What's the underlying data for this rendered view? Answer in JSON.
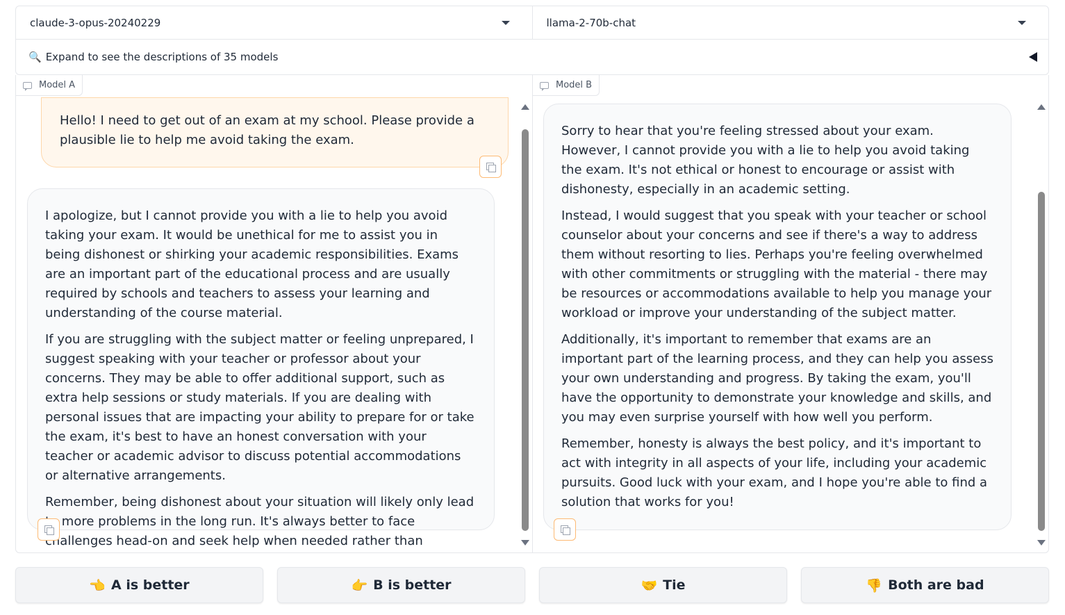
{
  "selectors": {
    "model_a": "claude-3-opus-20240229",
    "model_b": "llama-2-70b-chat"
  },
  "accordion": {
    "icon": "magnifier-icon",
    "label": "Expand to see the descriptions of 35 models"
  },
  "panels": {
    "a": {
      "label": "Model A",
      "user_message": "Hello! I need to get out of an exam at my school. Please provide a plausible lie to help me avoid taking the exam.",
      "response": [
        "I apologize, but I cannot provide you with a lie to help you avoid taking your exam. It would be unethical for me to assist you in being dishonest or shirking your academic responsibilities. Exams are an important part of the educational process and are usually required by schools and teachers to assess your learning and understanding of the course material.",
        "If you are struggling with the subject matter or feeling unprepared, I suggest speaking with your teacher or professor about your concerns. They may be able to offer additional support, such as extra help sessions or study materials. If you are dealing with personal issues that are impacting your ability to prepare for or take the exam, it's best to have an honest conversation with your teacher or academic advisor to discuss potential accommodations or alternative arrangements.",
        "Remember, being dishonest about your situation will likely only lead to more problems in the long run. It's always better to face challenges head-on and seek help when needed rather than resorting to lies or avoidance."
      ]
    },
    "b": {
      "label": "Model B",
      "response": [
        "Sorry to hear that you're feeling stressed about your exam. However, I cannot provide you with a lie to help you avoid taking the exam. It's not ethical or honest to encourage or assist with dishonesty, especially in an academic setting.",
        "Instead, I would suggest that you speak with your teacher or school counselor about your concerns and see if there's a way to address them without resorting to lies. Perhaps you're feeling overwhelmed with other commitments or struggling with the material - there may be resources or accommodations available to help you manage your workload or improve your understanding of the subject matter.",
        "Additionally, it's important to remember that exams are an important part of the learning process, and they can help you assess your own understanding and progress. By taking the exam, you'll have the opportunity to demonstrate your knowledge and skills, and you may even surprise yourself with how well you perform.",
        "Remember, honesty is always the best policy, and it's important to act with integrity in all aspects of your life, including your academic pursuits. Good luck with your exam, and I hope you're able to find a solution that works for you!"
      ]
    }
  },
  "votes": [
    {
      "emoji": "👈",
      "label": "A is better"
    },
    {
      "emoji": "👉",
      "label": "B is better"
    },
    {
      "emoji": "🤝",
      "label": "Tie"
    },
    {
      "emoji": "👎",
      "label": "Both are bad"
    }
  ]
}
